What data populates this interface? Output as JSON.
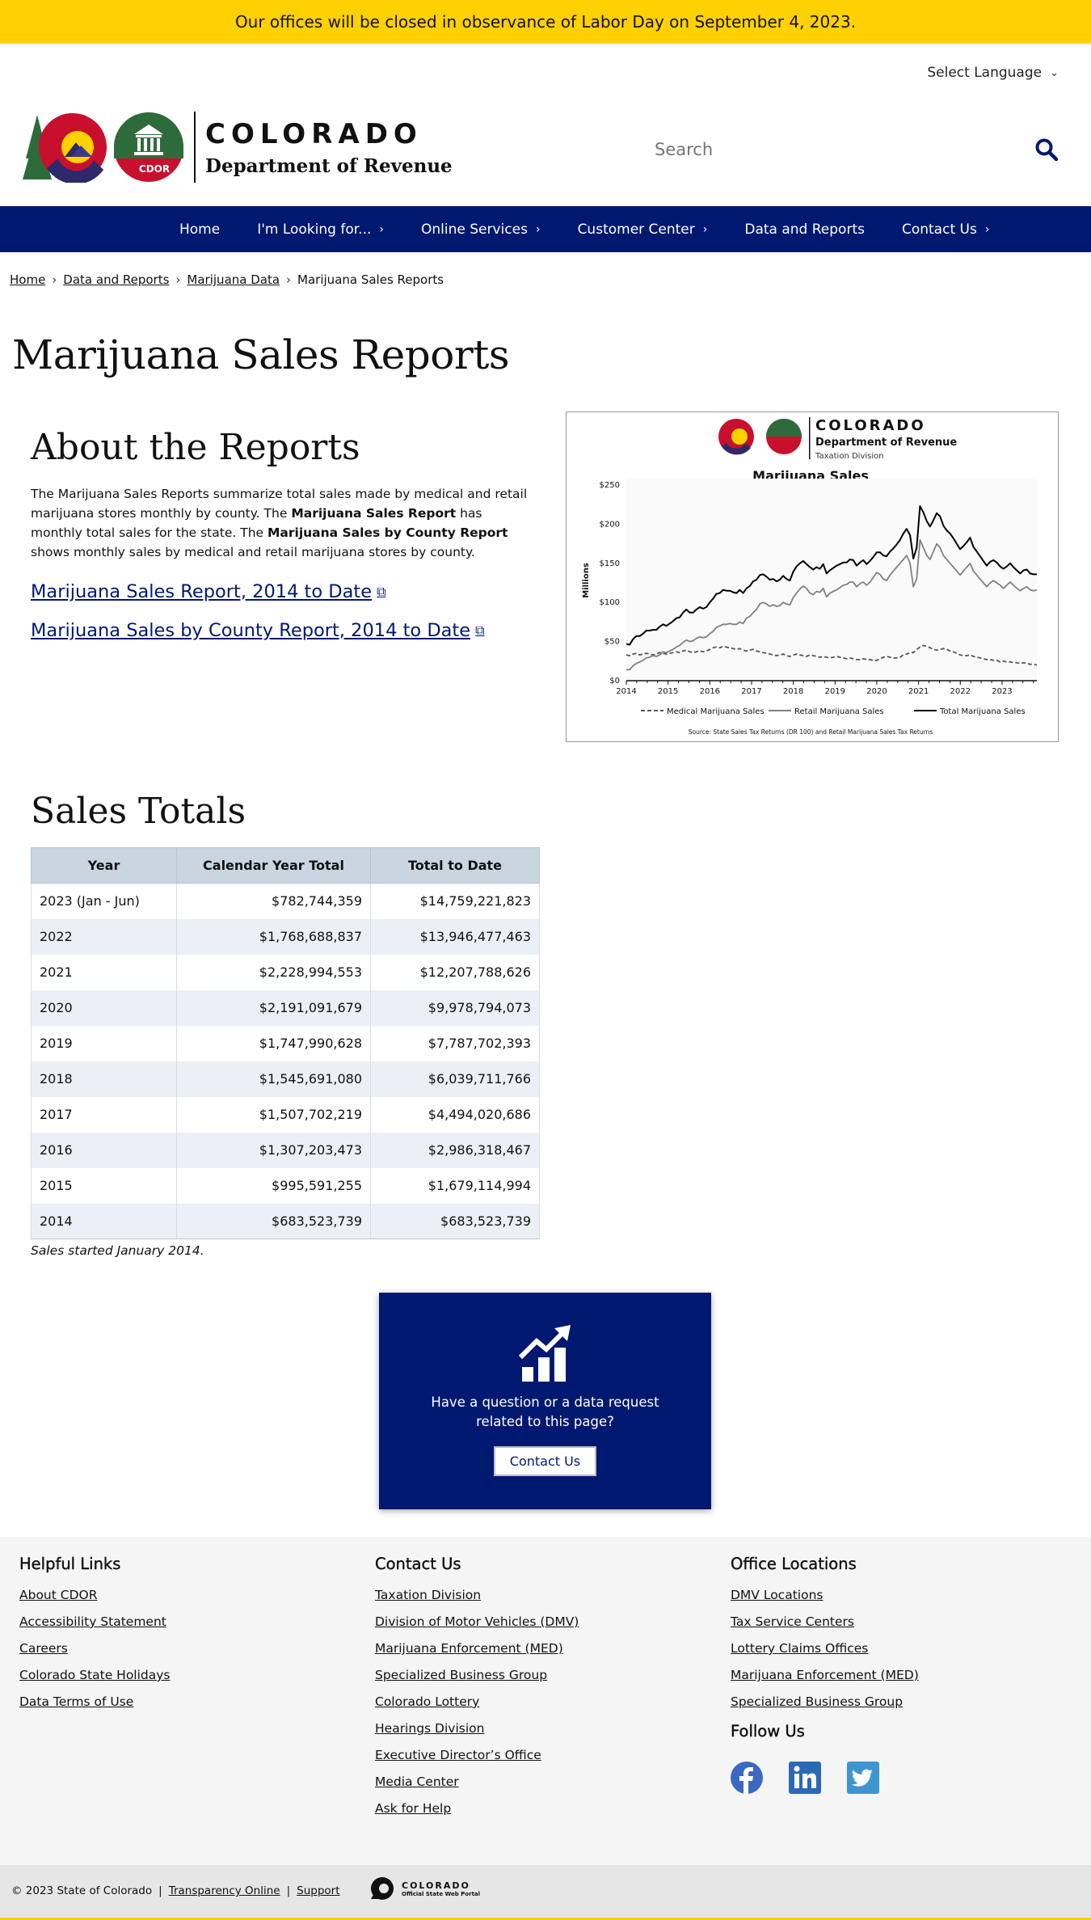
{
  "alert": {
    "text": "Our offices will be closed in observance of Labor Day on September 4, 2023."
  },
  "language": {
    "label": "Select Language"
  },
  "logo": {
    "state": "COLORADO",
    "dept": "Department of Revenue",
    "badge": "CDOR"
  },
  "search": {
    "placeholder": "Search"
  },
  "nav": {
    "items": [
      {
        "label": "Home"
      },
      {
        "label": "I'm Looking for..."
      },
      {
        "label": "Online Services"
      },
      {
        "label": "Customer Center"
      },
      {
        "label": "Data and Reports"
      },
      {
        "label": "Contact Us"
      }
    ]
  },
  "breadcrumb": {
    "home": "Home",
    "data": "Data and Reports",
    "mj": "Marijuana Data",
    "current": "Marijuana Sales Reports"
  },
  "page": {
    "title": "Marijuana Sales Reports"
  },
  "about": {
    "heading": "About the Reports",
    "p1": "The Marijuana Sales Reports summarize total sales made by medical and retail marijuana stores monthly by county. The ",
    "b1": "Marijuana Sales Report",
    "p2": " has monthly total sales for the state. The ",
    "b2": "Marijuana Sales by County Report",
    "p3": " shows monthly sales by medical and retail marijuana stores by county.",
    "link1": "Marijuana Sales Report, 2014 to Date",
    "link2": "Marijuana Sales by County Report, 2014 to Date"
  },
  "chart_data": {
    "type": "line",
    "header": {
      "state": "COLORADO",
      "dept": "Department of Revenue",
      "division": "Taxation Division"
    },
    "title": "Marijuana Sales",
    "ylabel": "Millions",
    "xlabel": "",
    "ylim": [
      0,
      250
    ],
    "yticks": [
      "$0",
      "$50",
      "$100",
      "$150",
      "$200",
      "$250"
    ],
    "xticks": [
      "2014",
      "2015",
      "2016",
      "2017",
      "2018",
      "2019",
      "2020",
      "2021",
      "2022",
      "2023"
    ],
    "x_start": "2014-01",
    "legend_position": "bottom",
    "source": "Source: State Sales Tax Returns (DR 100) and Retail Marijuana  Sales Tax Returns",
    "series": [
      {
        "name": "Medical Marijuana Sales",
        "style": "dashed",
        "color": "#555555",
        "values": [
          33,
          32,
          34,
          35,
          33,
          34,
          35,
          34,
          33,
          34,
          36,
          35,
          34,
          35,
          36,
          37,
          36,
          38,
          39,
          37,
          36,
          37,
          38,
          37,
          38,
          40,
          42,
          43,
          42,
          44,
          43,
          42,
          41,
          40,
          41,
          39,
          38,
          39,
          40,
          38,
          37,
          36,
          35,
          34,
          33,
          32,
          33,
          34,
          32,
          31,
          33,
          34,
          33,
          32,
          31,
          33,
          32,
          31,
          30,
          31,
          30,
          29,
          30,
          31,
          30,
          29,
          28,
          29,
          28,
          27,
          27,
          28,
          27,
          27,
          26,
          26,
          28,
          30,
          31,
          30,
          29,
          29,
          30,
          33,
          34,
          36,
          36,
          40,
          43,
          45,
          44,
          42,
          40,
          39,
          40,
          41,
          40,
          38,
          37,
          35,
          33,
          32,
          32,
          33,
          31,
          30,
          29,
          28,
          27,
          27,
          26,
          26,
          24,
          25,
          24,
          24,
          23,
          23,
          22,
          23,
          22,
          21,
          21,
          20
        ]
      },
      {
        "name": "Retail Marijuana Sales",
        "style": "solid",
        "color": "#808080",
        "values": [
          14,
          14,
          19,
          22,
          24,
          26,
          29,
          30,
          32,
          31,
          33,
          37,
          36,
          38,
          40,
          43,
          45,
          49,
          52,
          50,
          51,
          54,
          56,
          55,
          56,
          60,
          63,
          68,
          70,
          72,
          72,
          73,
          72,
          72,
          75,
          73,
          80,
          82,
          87,
          91,
          98,
          100,
          98,
          95,
          97,
          95,
          96,
          100,
          98,
          97,
          106,
          112,
          117,
          121,
          118,
          112,
          110,
          114,
          113,
          118,
          107,
          112,
          114,
          116,
          119,
          122,
          123,
          126,
          126,
          120,
          124,
          126,
          122,
          126,
          132,
          138,
          136,
          130,
          128,
          135,
          140,
          145,
          150,
          155,
          160,
          150,
          120,
          130,
          180,
          170,
          160,
          155,
          165,
          175,
          170,
          160,
          155,
          150,
          145,
          140,
          135,
          140,
          145,
          150,
          140,
          135,
          130,
          125,
          120,
          125,
          128,
          125,
          122,
          118,
          122,
          126,
          122,
          118,
          115,
          118,
          120,
          116,
          115,
          116
        ]
      },
      {
        "name": "Total Marijuana Sales",
        "style": "solid",
        "color": "#000000",
        "values": [
          47,
          46,
          53,
          57,
          57,
          60,
          64,
          64,
          65,
          65,
          69,
          72,
          70,
          73,
          76,
          80,
          81,
          87,
          91,
          87,
          87,
          91,
          94,
          92,
          94,
          100,
          105,
          111,
          112,
          116,
          115,
          115,
          113,
          112,
          116,
          112,
          118,
          121,
          127,
          129,
          135,
          136,
          133,
          129,
          130,
          127,
          129,
          134,
          130,
          128,
          139,
          146,
          150,
          153,
          149,
          145,
          142,
          145,
          143,
          149,
          137,
          141,
          144,
          147,
          149,
          151,
          151,
          155,
          154,
          147,
          151,
          154,
          149,
          153,
          158,
          164,
          164,
          160,
          159,
          165,
          169,
          174,
          180,
          188,
          194,
          186,
          156,
          170,
          223,
          215,
          204,
          197,
          205,
          214,
          210,
          198,
          192,
          188,
          182,
          175,
          168,
          172,
          177,
          183,
          171,
          165,
          159,
          153,
          147,
          152,
          154,
          151,
          146,
          143,
          146,
          150,
          145,
          141,
          137,
          141,
          142,
          137,
          136,
          136
        ]
      }
    ]
  },
  "totals": {
    "heading": "Sales Totals",
    "columns": [
      "Year",
      "Calendar Year Total",
      "Total to Date"
    ],
    "rows": [
      [
        "2023 (Jan - Jun)",
        "$782,744,359",
        "$14,759,221,823"
      ],
      [
        "2022",
        "$1,768,688,837",
        "$13,946,477,463"
      ],
      [
        "2021",
        "$2,228,994,553",
        "$12,207,788,626"
      ],
      [
        "2020",
        "$2,191,091,679",
        "$9,978,794,073"
      ],
      [
        "2019",
        "$1,747,990,628",
        "$7,787,702,393"
      ],
      [
        "2018",
        "$1,545,691,080",
        "$6,039,711,766"
      ],
      [
        "2017",
        "$1,507,702,219",
        "$4,494,020,686"
      ],
      [
        "2016",
        "$1,307,203,473",
        "$2,986,318,467"
      ],
      [
        "2015",
        "$995,591,255",
        "$1,679,114,994"
      ],
      [
        "2014",
        "$683,523,739",
        "$683,523,739"
      ]
    ],
    "note": "Sales started January 2014."
  },
  "cta": {
    "icon": "chart-growth-icon",
    "question": "Have a question or a data request related to this page?",
    "button": "Contact Us"
  },
  "footer": {
    "helpful": {
      "heading": "Helpful Links",
      "links": [
        "About CDOR",
        "Accessibility Statement",
        "Careers",
        "Colorado State Holidays",
        "Data Terms of Use"
      ]
    },
    "contact": {
      "heading": "Contact Us",
      "links": [
        "Taxation Division",
        "Division of Motor Vehicles (DMV)",
        "Marijuana Enforcement (MED)",
        "Specialized Business Group",
        "Colorado Lottery",
        "Hearings Division",
        "Executive Director’s Office",
        "Media Center",
        "Ask for Help"
      ]
    },
    "offices": {
      "heading": "Office Locations",
      "links": [
        "DMV Locations",
        "Tax Service Centers",
        "Lottery Claims Offices",
        "Marijuana Enforcement (MED)",
        "Specialized Business Group"
      ]
    },
    "follow": {
      "heading": "Follow Us",
      "icons": [
        "facebook-icon",
        "linkedin-icon",
        "twitter-icon"
      ]
    }
  },
  "bottom": {
    "copyright": "© 2023 State of Colorado",
    "transparency": "Transparency Online",
    "support": "Support",
    "portal_title": "COLORADO",
    "portal_sub": "Official State Web Portal"
  },
  "colors": {
    "navy": "#001970",
    "alert": "#ffd100",
    "table_head": "#c9d5e1"
  }
}
